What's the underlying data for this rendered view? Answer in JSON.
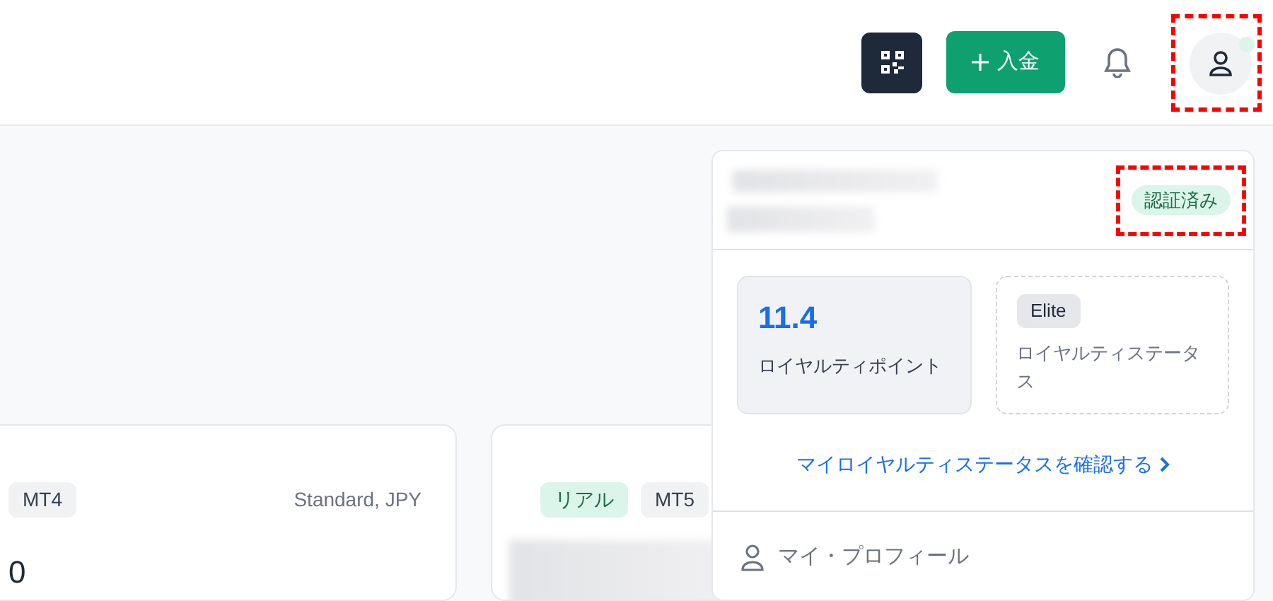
{
  "header": {
    "deposit_button": {
      "label": "入金"
    },
    "avatar": {
      "online": true,
      "highlighted": true
    }
  },
  "accounts": [
    {
      "badges": [
        {
          "label": "MT4",
          "kind": "platform"
        }
      ],
      "account_type": "Standard, JPY",
      "balance": "0"
    },
    {
      "badges": [
        {
          "label": "リアル",
          "kind": "real"
        },
        {
          "label": "MT5",
          "kind": "platform"
        }
      ]
    }
  ],
  "profile_menu": {
    "verification_badge": {
      "label": "認証済み",
      "highlighted": true
    },
    "points": {
      "value": "11.4",
      "label": "ロイヤルティポイント"
    },
    "status": {
      "tier": "Elite",
      "label": "ロイヤルティステータス"
    },
    "status_link": "マイロイヤルティステータスを確認する",
    "items": [
      {
        "label": "マイ・プロフィール"
      }
    ]
  }
}
